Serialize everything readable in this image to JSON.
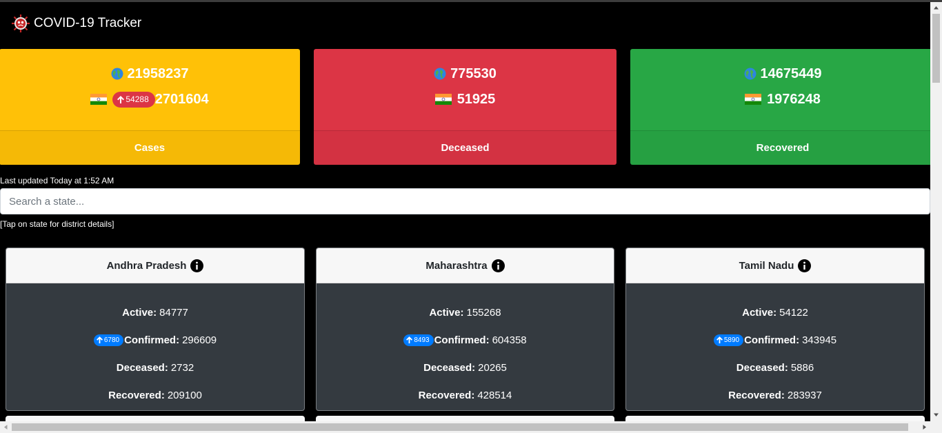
{
  "app": {
    "title": "COVID-19 Tracker"
  },
  "summary": {
    "cases": {
      "label": "Cases",
      "world": "21958237",
      "india": "2701604",
      "india_delta": "54288"
    },
    "deceased": {
      "label": "Deceased",
      "world": "775530",
      "india": "51925"
    },
    "recovered": {
      "label": "Recovered",
      "world": "14675449",
      "india": "1976248"
    }
  },
  "last_updated": "Last updated Today at 1:52 AM",
  "search": {
    "placeholder": "Search a state..."
  },
  "tap_hint": "[Tap on state for district details]",
  "labels": {
    "active": "Active:",
    "confirmed": "Confirmed:",
    "deceased": "Deceased:",
    "recovered": "Recovered:"
  },
  "states": [
    {
      "name": "Andhra Pradesh",
      "active": "84777",
      "confirmed": "296609",
      "confirmed_delta": "6780",
      "deceased": "2732",
      "recovered": "209100"
    },
    {
      "name": "Maharashtra",
      "active": "155268",
      "confirmed": "604358",
      "confirmed_delta": "8493",
      "deceased": "20265",
      "recovered": "428514"
    },
    {
      "name": "Tamil Nadu",
      "active": "54122",
      "confirmed": "343945",
      "confirmed_delta": "5890",
      "deceased": "5886",
      "recovered": "283937"
    }
  ],
  "colors": {
    "cases": "#ffc107",
    "deceased": "#dc3545",
    "recovered": "#28a745",
    "delta_badge_red": "#dc3545",
    "delta_badge_blue": "#007bff"
  }
}
